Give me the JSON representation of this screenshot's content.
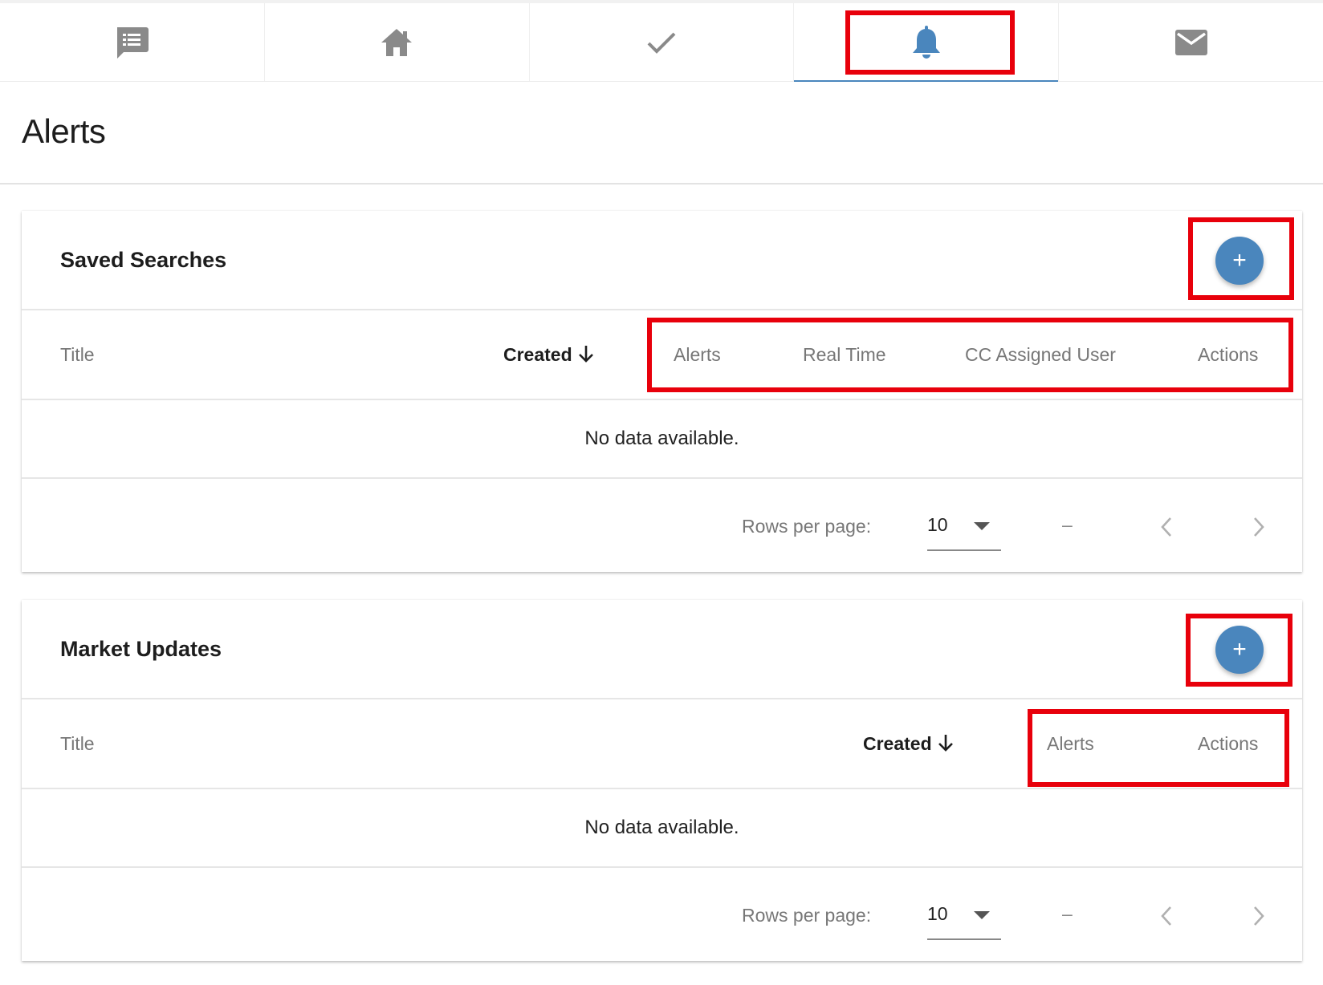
{
  "tabs": [
    {
      "icon": "message-list-icon",
      "active": false
    },
    {
      "icon": "home-icon",
      "active": false
    },
    {
      "icon": "check-icon",
      "active": false
    },
    {
      "icon": "bell-icon",
      "active": true
    },
    {
      "icon": "mail-icon",
      "active": false
    }
  ],
  "colors": {
    "accent": "#4a86bd",
    "highlight": "#e8000b",
    "icon_gray": "#8a8a8a"
  },
  "page": {
    "title": "Alerts"
  },
  "saved_searches": {
    "title": "Saved Searches",
    "add_label": "+",
    "columns": [
      "Title",
      "Created",
      "Alerts",
      "Real Time",
      "CC Assigned User",
      "Actions"
    ],
    "sort_column": "Created",
    "empty_text": "No data available.",
    "footer": {
      "rows_per_page_label": "Rows per page:",
      "rows_per_page": "10",
      "range": "–"
    }
  },
  "market_updates": {
    "title": "Market Updates",
    "add_label": "+",
    "columns": [
      "Title",
      "Created",
      "Alerts",
      "Actions"
    ],
    "sort_column": "Created",
    "empty_text": "No data available.",
    "footer": {
      "rows_per_page_label": "Rows per page:",
      "rows_per_page": "10",
      "range": "–"
    }
  }
}
